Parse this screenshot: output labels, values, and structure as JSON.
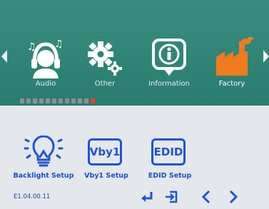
{
  "menu": {
    "categories": [
      {
        "label": "Audio",
        "icon": "headset-person-icon",
        "selected": false
      },
      {
        "label": "Other",
        "icon": "gears-icon",
        "selected": false
      },
      {
        "label": "Information",
        "icon": "info-icon",
        "selected": false
      },
      {
        "label": "Factory",
        "icon": "factory-icon",
        "selected": true
      }
    ],
    "page_indicator": {
      "total": 12,
      "current": 12
    }
  },
  "submenu": {
    "items": [
      {
        "label": "Backlight Setup",
        "icon": "lightbulb-icon"
      },
      {
        "label": "Vby1 Setup",
        "icon_text": "Vby1"
      },
      {
        "label": "EDID Setup",
        "icon_text": "EDID"
      }
    ]
  },
  "footer": {
    "version": "E1.04.00.11",
    "buttons": [
      "enter-icon",
      "exit-icon",
      "chevron-left-icon",
      "chevron-right-icon"
    ]
  },
  "colors": {
    "header_bg": "#2f8576",
    "panel_bg": "#e4e7ec",
    "accent_blue": "#1d55d0",
    "factory_orange": "#f07a1e",
    "indicator_current": "#ff3b2a"
  }
}
